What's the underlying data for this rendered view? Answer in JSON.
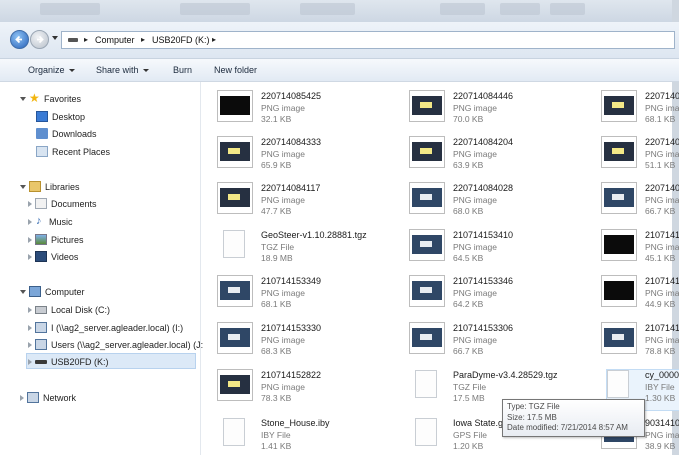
{
  "address": {
    "crumbs": [
      "Computer",
      "USB20FD (K:)"
    ]
  },
  "toolbar": {
    "organize": "Organize",
    "share_with": "Share with",
    "burn": "Burn",
    "new_folder": "New folder"
  },
  "nav": {
    "favorites": "Favorites",
    "desktop": "Desktop",
    "downloads": "Downloads",
    "recent_places": "Recent Places",
    "libraries": "Libraries",
    "documents": "Documents",
    "music": "Music",
    "pictures": "Pictures",
    "videos": "Videos",
    "computer": "Computer",
    "local_disk": "Local Disk (C:)",
    "drive_i": "I (\\\\ag2_server.agleader.local) (I:)",
    "drive_j": "Users (\\\\ag2_server.agleader.local) (J:",
    "usb": "USB20FD (K:)",
    "network": "Network"
  },
  "files": [
    {
      "name": "220714085425",
      "type": "PNG image",
      "size": "32.1 KB"
    },
    {
      "name": "220714084446",
      "type": "PNG image",
      "size": "70.0 KB"
    },
    {
      "name": "22071408",
      "type": "PNG imag",
      "size": "68.1 KB"
    },
    {
      "name": "220714084333",
      "type": "PNG image",
      "size": "65.9 KB"
    },
    {
      "name": "220714084204",
      "type": "PNG image",
      "size": "63.9 KB"
    },
    {
      "name": "22071408",
      "type": "PNG imag",
      "size": "51.1 KB"
    },
    {
      "name": "220714084117",
      "type": "PNG image",
      "size": "47.7 KB"
    },
    {
      "name": "220714084028",
      "type": "PNG image",
      "size": "68.0 KB"
    },
    {
      "name": "22071408",
      "type": "PNG imag",
      "size": "66.7 KB"
    },
    {
      "name": "GeoSteer-v1.10.28881.tgz",
      "type": "TGZ File",
      "size": "18.9 MB"
    },
    {
      "name": "210714153410",
      "type": "PNG image",
      "size": "64.5 KB"
    },
    {
      "name": "21071415",
      "type": "PNG imag",
      "size": "45.1 KB"
    },
    {
      "name": "210714153349",
      "type": "PNG image",
      "size": "68.1 KB"
    },
    {
      "name": "210714153346",
      "type": "PNG image",
      "size": "64.2 KB"
    },
    {
      "name": "21071415",
      "type": "PNG imag",
      "size": "44.9 KB"
    },
    {
      "name": "210714153330",
      "type": "PNG image",
      "size": "68.3 KB"
    },
    {
      "name": "210714153306",
      "type": "PNG image",
      "size": "66.7 KB"
    },
    {
      "name": "21071415",
      "type": "PNG imag",
      "size": "78.8 KB"
    },
    {
      "name": "210714152822",
      "type": "PNG image",
      "size": "78.3 KB"
    },
    {
      "name": "ParaDyme-v3.4.28529.tgz",
      "type": "TGZ File",
      "size": "17.5 MB"
    },
    {
      "name": "cy_00004",
      "type": "IBY File",
      "size": "1.30 KB"
    },
    {
      "name": "Stone_House.iby",
      "type": "IBY File",
      "size": "1.41 KB"
    },
    {
      "name": "Iowa State.gp",
      "type": "GPS File",
      "size": "1.20 KB"
    },
    {
      "name": "90314101",
      "type": "PNG imag",
      "size": "38.9 KB"
    }
  ],
  "tooltip": {
    "type": "Type: TGZ File",
    "size": "Size: 17.5 MB",
    "date": "Date modified: 7/21/2014 8:57 AM"
  }
}
